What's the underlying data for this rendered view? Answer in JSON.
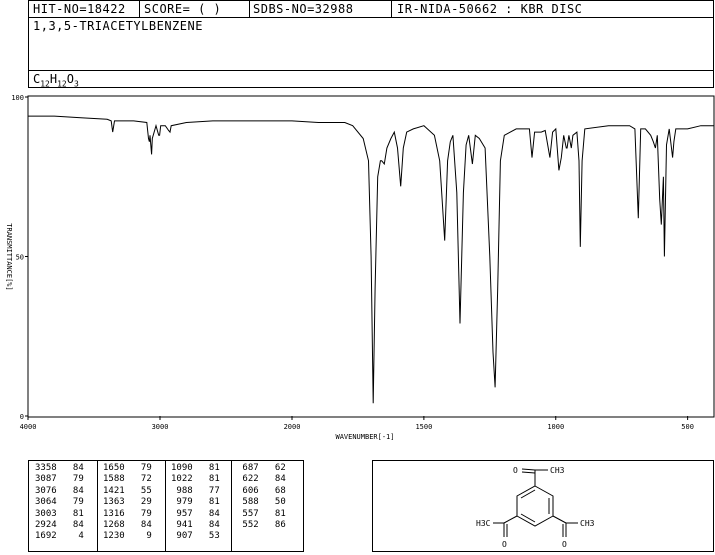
{
  "header": {
    "hit_no": "HIT-NO=18422",
    "score": "SCORE=  (   )",
    "sdbs_no": "SDBS-NO=32988",
    "ir_id": "IR-NIDA-50662 : KBR DISC"
  },
  "compound": {
    "name": "1,3,5-TRIACETYLBENZENE",
    "formula_parts": {
      "c": "C",
      "c_n": "12",
      "h": "H",
      "h_n": "12",
      "o": "O",
      "o_n": "3"
    }
  },
  "chart_data": {
    "type": "line",
    "xlabel": "WAVENUMBER[-1]",
    "ylabel": "TRANSMITTANCE[%]",
    "xlim": [
      4000,
      400
    ],
    "ylim": [
      0,
      100
    ],
    "x_ticks": [
      4000,
      3000,
      2000,
      1500,
      1000,
      500
    ],
    "y_ticks": [
      0,
      50,
      100
    ],
    "grid": false,
    "series": [
      {
        "values": [
          [
            4000,
            94
          ],
          [
            3800,
            94
          ],
          [
            3600,
            93.5
          ],
          [
            3400,
            93
          ],
          [
            3370,
            92.5
          ],
          [
            3358,
            89
          ],
          [
            3345,
            92.5
          ],
          [
            3200,
            92.5
          ],
          [
            3100,
            92
          ],
          [
            3087,
            87
          ],
          [
            3080,
            86
          ],
          [
            3076,
            88
          ],
          [
            3070,
            85
          ],
          [
            3064,
            82
          ],
          [
            3058,
            87
          ],
          [
            3030,
            91
          ],
          [
            3010,
            88
          ],
          [
            3003,
            88
          ],
          [
            2995,
            91
          ],
          [
            2960,
            91
          ],
          [
            2935,
            89.5
          ],
          [
            2924,
            89
          ],
          [
            2915,
            91
          ],
          [
            2800,
            92
          ],
          [
            2600,
            92.5
          ],
          [
            2400,
            92.5
          ],
          [
            2200,
            92.5
          ],
          [
            2000,
            92.5
          ],
          [
            1900,
            92
          ],
          [
            1800,
            92
          ],
          [
            1770,
            91
          ],
          [
            1730,
            87
          ],
          [
            1710,
            80
          ],
          [
            1700,
            50
          ],
          [
            1692,
            4
          ],
          [
            1685,
            40
          ],
          [
            1675,
            75
          ],
          [
            1665,
            80
          ],
          [
            1660,
            80
          ],
          [
            1650,
            79
          ],
          [
            1640,
            84
          ],
          [
            1625,
            87
          ],
          [
            1612,
            89
          ],
          [
            1600,
            84
          ],
          [
            1588,
            72
          ],
          [
            1578,
            84
          ],
          [
            1565,
            89
          ],
          [
            1540,
            90
          ],
          [
            1500,
            91
          ],
          [
            1460,
            88
          ],
          [
            1440,
            80
          ],
          [
            1421,
            55
          ],
          [
            1410,
            80
          ],
          [
            1400,
            86
          ],
          [
            1390,
            88
          ],
          [
            1375,
            70
          ],
          [
            1363,
            29
          ],
          [
            1350,
            70
          ],
          [
            1340,
            85
          ],
          [
            1330,
            88
          ],
          [
            1316,
            79
          ],
          [
            1305,
            88
          ],
          [
            1290,
            87
          ],
          [
            1268,
            84
          ],
          [
            1250,
            50
          ],
          [
            1238,
            20
          ],
          [
            1230,
            9
          ],
          [
            1220,
            40
          ],
          [
            1210,
            80
          ],
          [
            1195,
            88
          ],
          [
            1150,
            90
          ],
          [
            1100,
            90
          ],
          [
            1090,
            81
          ],
          [
            1080,
            89
          ],
          [
            1055,
            89
          ],
          [
            1040,
            89.5
          ],
          [
            1022,
            81
          ],
          [
            1012,
            89
          ],
          [
            1000,
            90
          ],
          [
            988,
            77
          ],
          [
            979,
            81
          ],
          [
            970,
            88
          ],
          [
            960,
            84
          ],
          [
            957,
            84
          ],
          [
            950,
            88
          ],
          [
            941,
            84
          ],
          [
            935,
            88
          ],
          [
            920,
            89
          ],
          [
            912,
            80
          ],
          [
            907,
            53
          ],
          [
            900,
            80
          ],
          [
            890,
            90
          ],
          [
            800,
            91
          ],
          [
            720,
            91
          ],
          [
            700,
            90
          ],
          [
            687,
            62
          ],
          [
            678,
            90
          ],
          [
            660,
            90
          ],
          [
            640,
            88
          ],
          [
            630,
            86
          ],
          [
            622,
            84
          ],
          [
            615,
            88
          ],
          [
            606,
            68
          ],
          [
            600,
            60
          ],
          [
            592,
            75
          ],
          [
            588,
            50
          ],
          [
            580,
            85
          ],
          [
            570,
            90
          ],
          [
            557,
            81
          ],
          [
            552,
            86
          ],
          [
            545,
            90
          ],
          [
            500,
            90
          ],
          [
            450,
            91
          ],
          [
            400,
            91
          ]
        ]
      }
    ]
  },
  "peak_table": {
    "columns": [
      [
        [
          "3358",
          "84"
        ],
        [
          "3087",
          "79"
        ],
        [
          "3076",
          "84"
        ],
        [
          "3064",
          "79"
        ],
        [
          "3003",
          "81"
        ],
        [
          "2924",
          "84"
        ],
        [
          "1692",
          "4"
        ]
      ],
      [
        [
          "1650",
          "79"
        ],
        [
          "1588",
          "72"
        ],
        [
          "1421",
          "55"
        ],
        [
          "1363",
          "29"
        ],
        [
          "1316",
          "79"
        ],
        [
          "1268",
          "84"
        ],
        [
          "1230",
          "9"
        ]
      ],
      [
        [
          "1090",
          "81"
        ],
        [
          "1022",
          "81"
        ],
        [
          "988",
          "77"
        ],
        [
          "979",
          "81"
        ],
        [
          "957",
          "84"
        ],
        [
          "941",
          "84"
        ],
        [
          "907",
          "53"
        ]
      ],
      [
        [
          "687",
          "62"
        ],
        [
          "622",
          "84"
        ],
        [
          "606",
          "68"
        ],
        [
          "588",
          "50"
        ],
        [
          "557",
          "81"
        ],
        [
          "552",
          "86"
        ]
      ]
    ]
  },
  "structure": {
    "top_o": "O",
    "top_ch3": "CH3",
    "left_ch3": "H3C",
    "right_ch3": "CH3",
    "left_o": "O",
    "right_o": "O"
  }
}
